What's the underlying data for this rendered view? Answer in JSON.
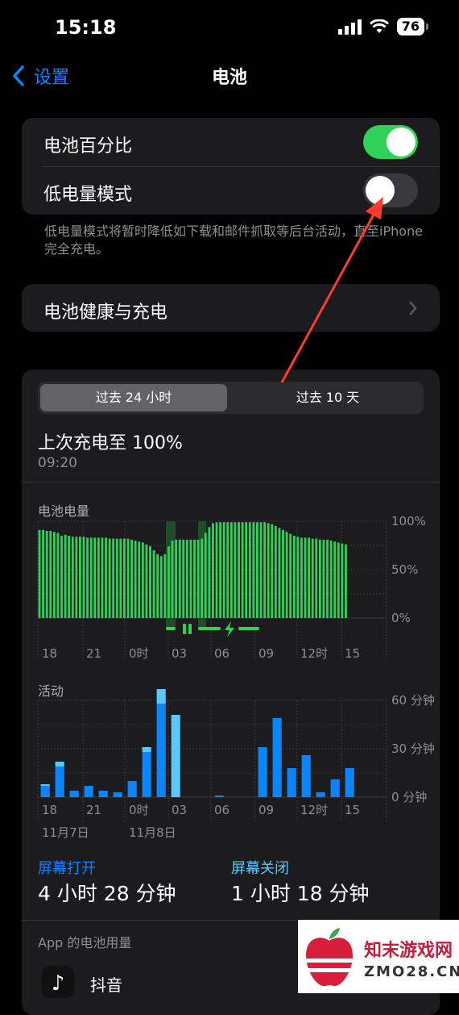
{
  "status": {
    "time": "15:18",
    "battery": "76"
  },
  "nav": {
    "back_label": "设置",
    "title": "电池"
  },
  "settings": {
    "battery_percentage_label": "电池百分比",
    "battery_percentage_on": true,
    "low_power_label": "低电量模式",
    "low_power_on": false,
    "low_power_footnote": "低电量模式将暂时降低如下载和邮件抓取等后台活动，直至iPhone完全充电。",
    "health_label": "电池健康与充电"
  },
  "usage": {
    "tabs": [
      "过去 24 小时",
      "过去 10 天"
    ],
    "selected_tab": 0,
    "last_charged": "上次充电至 100%",
    "last_charged_time": "09:20",
    "battery_chart_title": "电池电量",
    "activity_chart_title": "活动",
    "screen_on_label": "屏幕打开",
    "screen_on_value": "4 小时 28 分钟",
    "screen_off_label": "屏幕关闭",
    "screen_off_value": "1 小时 18 分钟",
    "app_usage_header": "App 的电池用量",
    "first_app": "抖音"
  },
  "watermark": {
    "text": "知末游戏网",
    "sub": "ZMO28.CN"
  },
  "colors": {
    "accent": "#0a84ff",
    "toggle_on": "#30d158",
    "battery_bar": "#30d158",
    "activity_bar": "#0a84ff",
    "activity_light": "#5ac8fa"
  },
  "chart_data": [
    {
      "type": "bar",
      "title": "电池电量",
      "x_ticks": [
        "18",
        "21",
        "0时",
        "03",
        "06",
        "09",
        "12时",
        "15"
      ],
      "y_ticks": [
        "100%",
        "50%",
        "0%"
      ],
      "ylim": [
        0,
        100
      ],
      "values": [
        91,
        91,
        90,
        90,
        89,
        88,
        85,
        86,
        85,
        84,
        84,
        84,
        84,
        83,
        83,
        83,
        83,
        83,
        83,
        82,
        82,
        82,
        82,
        82,
        82,
        81,
        80,
        79,
        78,
        76,
        74,
        70,
        66,
        64,
        66,
        74,
        80,
        81,
        81,
        81,
        81,
        81,
        81,
        81,
        82,
        88,
        94,
        98,
        99,
        99,
        99,
        99,
        99,
        99,
        99,
        99,
        99,
        99,
        99,
        99,
        99,
        99,
        98,
        97,
        95,
        93,
        91,
        89,
        87,
        85,
        84,
        83,
        83,
        83,
        82,
        82,
        81,
        81,
        81,
        80,
        79,
        78,
        77,
        76
      ]
    },
    {
      "type": "bar",
      "title": "活动",
      "x_ticks": [
        "18",
        "21",
        "0时",
        "03",
        "06",
        "09",
        "12时",
        "15"
      ],
      "date_labels": [
        "11月7日",
        "11月8日"
      ],
      "y_ticks": [
        "60 分钟",
        "30 分钟",
        "0 分钟"
      ],
      "ylim": [
        0,
        60
      ],
      "series": [
        {
          "name": "屏幕打开",
          "values": [
            7,
            19,
            4,
            7,
            4,
            3,
            10,
            28,
            58,
            51,
            0,
            0,
            1,
            0,
            0,
            31,
            49,
            18,
            26,
            3,
            11,
            18
          ]
        },
        {
          "name": "屏幕关闭",
          "values": [
            1,
            3,
            0,
            0,
            0,
            0,
            0,
            3,
            9,
            0,
            0,
            0,
            0,
            0,
            0,
            0,
            0,
            0,
            0,
            0,
            0,
            0
          ]
        }
      ]
    }
  ]
}
